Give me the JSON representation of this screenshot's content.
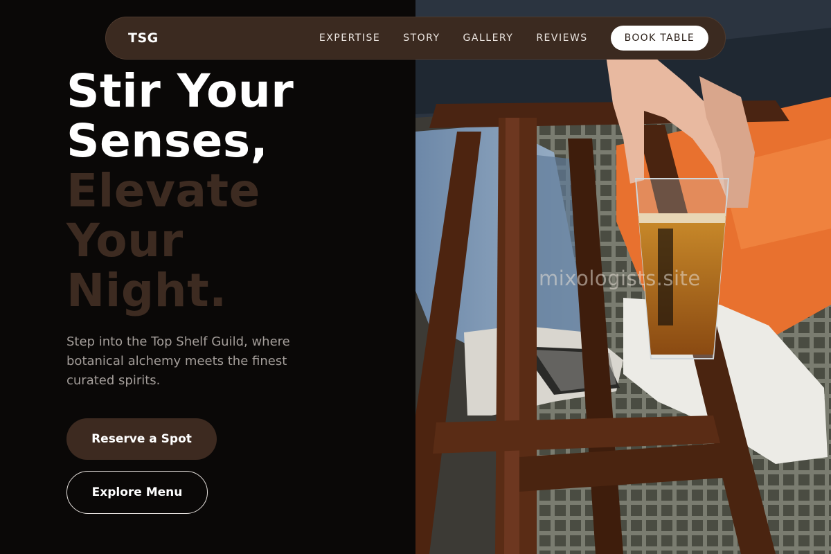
{
  "nav": {
    "brand": "TSG",
    "links": [
      "EXPERTISE",
      "STORY",
      "GALLERY",
      "REVIEWS"
    ],
    "cta": "BOOK TABLE"
  },
  "hero": {
    "line1": "Stir Your",
    "line2": "Senses,",
    "line3": "Elevate",
    "line4": "Your",
    "line5": "Night.",
    "subtitle": "Step into the Top Shelf Guild, where botanical alchemy meets the finest curated spirits.",
    "primary_button": "Reserve a Spot",
    "secondary_button": "Explore Menu"
  },
  "photo": {
    "watermark": "mixologists.site"
  },
  "colors": {
    "background": "#0a0807",
    "accent_brown": "#3d2a20",
    "nav_bg": "#3b2a20",
    "text_white": "#ffffff",
    "text_muted": "#a49e9a"
  }
}
